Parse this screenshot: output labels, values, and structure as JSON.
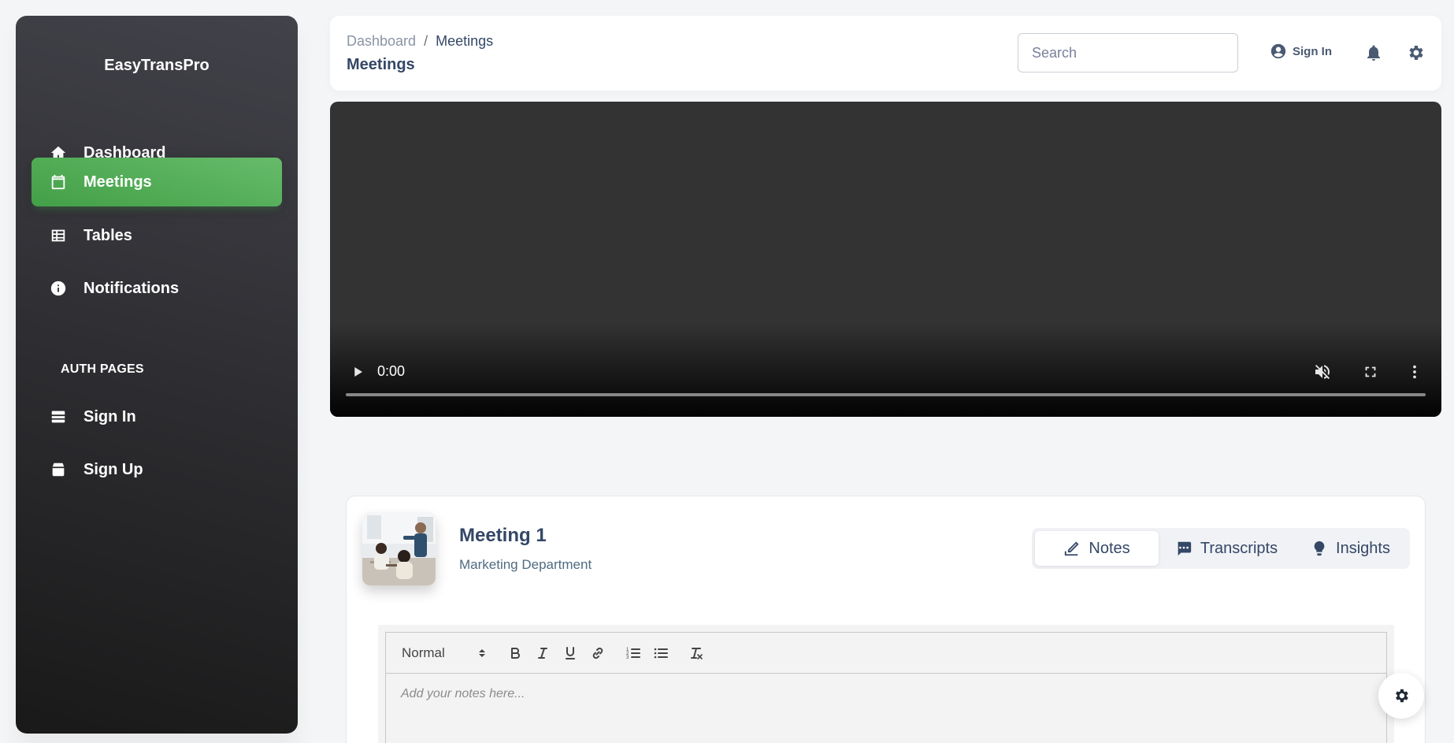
{
  "sidebar": {
    "brand": "EasyTransPro",
    "items": [
      {
        "label": "Dashboard",
        "icon": "home-icon"
      },
      {
        "label": "Meetings",
        "icon": "calendar-icon",
        "active": true
      },
      {
        "label": "Tables",
        "icon": "table-icon"
      },
      {
        "label": "Notifications",
        "icon": "info-icon"
      }
    ],
    "auth_section_title": "AUTH PAGES",
    "auth_items": [
      {
        "label": "Sign In",
        "icon": "login-icon"
      },
      {
        "label": "Sign Up",
        "icon": "signup-icon"
      }
    ],
    "active_color": "#4caf50"
  },
  "header": {
    "breadcrumb": {
      "parent": "Dashboard",
      "separator": "/",
      "current": "Meetings"
    },
    "title": "Meetings",
    "search": {
      "placeholder": "Search",
      "value": ""
    },
    "signin_label": "Sign In"
  },
  "video": {
    "time": "0:00",
    "controls": [
      "play-icon",
      "mute-icon",
      "fullscreen-icon",
      "more-vert-icon"
    ],
    "progress": 0
  },
  "meeting": {
    "title": "Meeting 1",
    "department": "Marketing Department",
    "tabs": [
      {
        "label": "Notes",
        "icon": "edit-icon",
        "active": true
      },
      {
        "label": "Transcripts",
        "icon": "chat-icon"
      },
      {
        "label": "Insights",
        "icon": "lightbulb-icon"
      }
    ]
  },
  "editor": {
    "format_select": "Normal",
    "tools": [
      "bold",
      "italic",
      "underline",
      "link",
      "ordered-list",
      "bullet-list",
      "clear-format"
    ],
    "placeholder": "Add your notes here..."
  }
}
